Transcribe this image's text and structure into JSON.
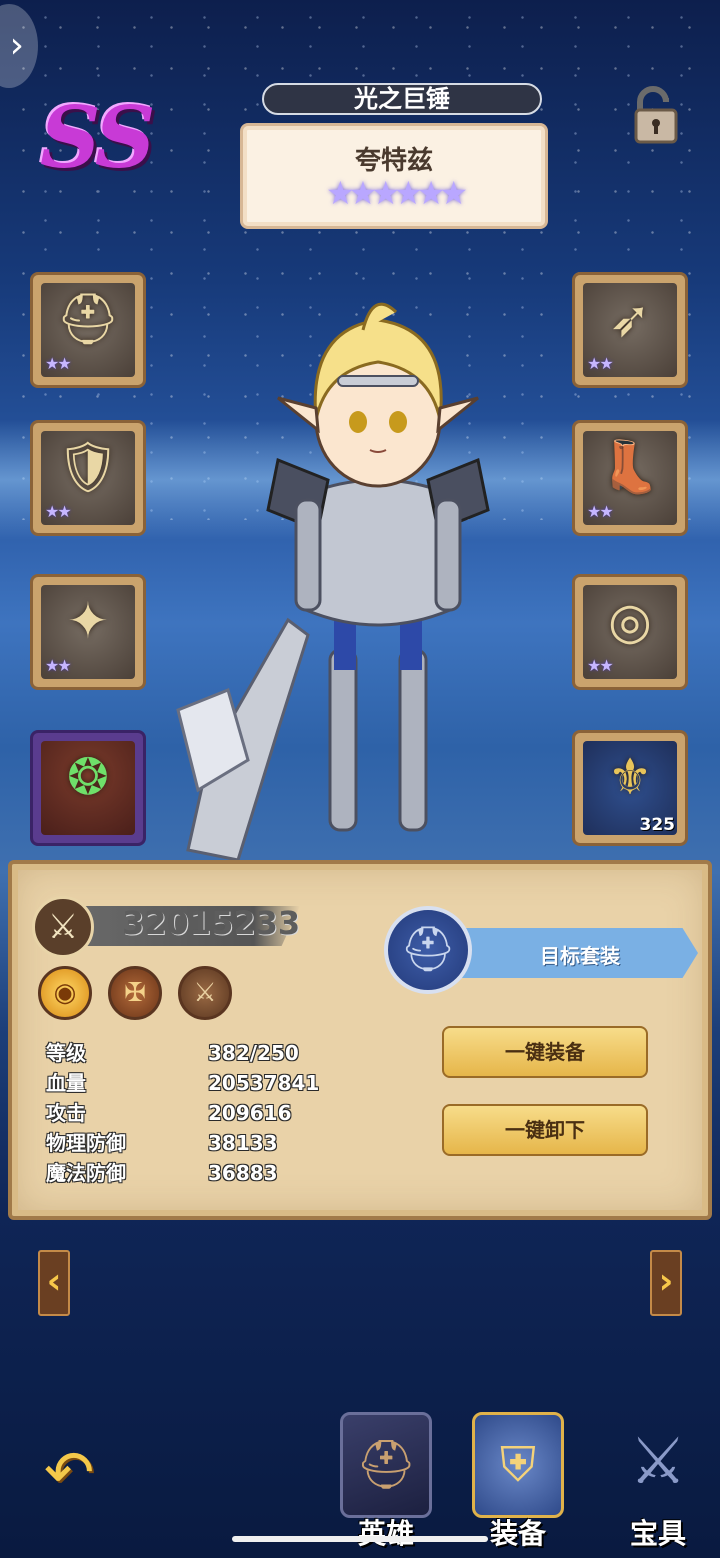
{
  "header": {
    "rank": "SS",
    "weapon_title": "光之巨锤",
    "hero_name": "夸特兹",
    "star_display": "★★★★★★"
  },
  "equipment_left": [
    {
      "icon": "helmet-icon",
      "glyph": "⛑",
      "stars": "★★"
    },
    {
      "icon": "chest-armor-icon",
      "glyph": "🛡",
      "stars": "★★"
    },
    {
      "icon": "shield-icon",
      "glyph": "✦",
      "stars": "★★"
    },
    {
      "icon": "gem-crest-icon",
      "glyph": "❂",
      "stars": ""
    }
  ],
  "equipment_right": [
    {
      "icon": "bow-icon",
      "glyph": "➶",
      "stars": "★★"
    },
    {
      "icon": "boots-icon",
      "glyph": "👢",
      "stars": "★★"
    },
    {
      "icon": "ring-icon",
      "glyph": "◎",
      "stars": "★★"
    },
    {
      "icon": "emblem-icon",
      "glyph": "⚜",
      "count": "325"
    }
  ],
  "panel": {
    "power": "32015233",
    "target_set_label": "目标套装",
    "equip_all_label": "一键装备",
    "unequip_all_label": "一键卸下",
    "stats": [
      {
        "label": "等级",
        "value": "382/250"
      },
      {
        "label": "血量",
        "value": "20537841"
      },
      {
        "label": "攻击",
        "value": "209616"
      },
      {
        "label": "物理防御",
        "value": "38133"
      },
      {
        "label": "魔法防御",
        "value": "36883"
      }
    ]
  },
  "nav": {
    "prev": "‹",
    "next": "›",
    "back": "↶"
  },
  "tabs": [
    {
      "label": "英雄",
      "icon": "hero-helmet-icon"
    },
    {
      "label": "装备",
      "icon": "equipment-chest-icon"
    },
    {
      "label": "宝具",
      "icon": "crossed-swords-icon"
    }
  ],
  "colors": {
    "rank": "#c83ad6",
    "panel_bg": "#e9d2a8",
    "gold_button": "#e6b64a",
    "target_set": "#7ab0e4"
  }
}
